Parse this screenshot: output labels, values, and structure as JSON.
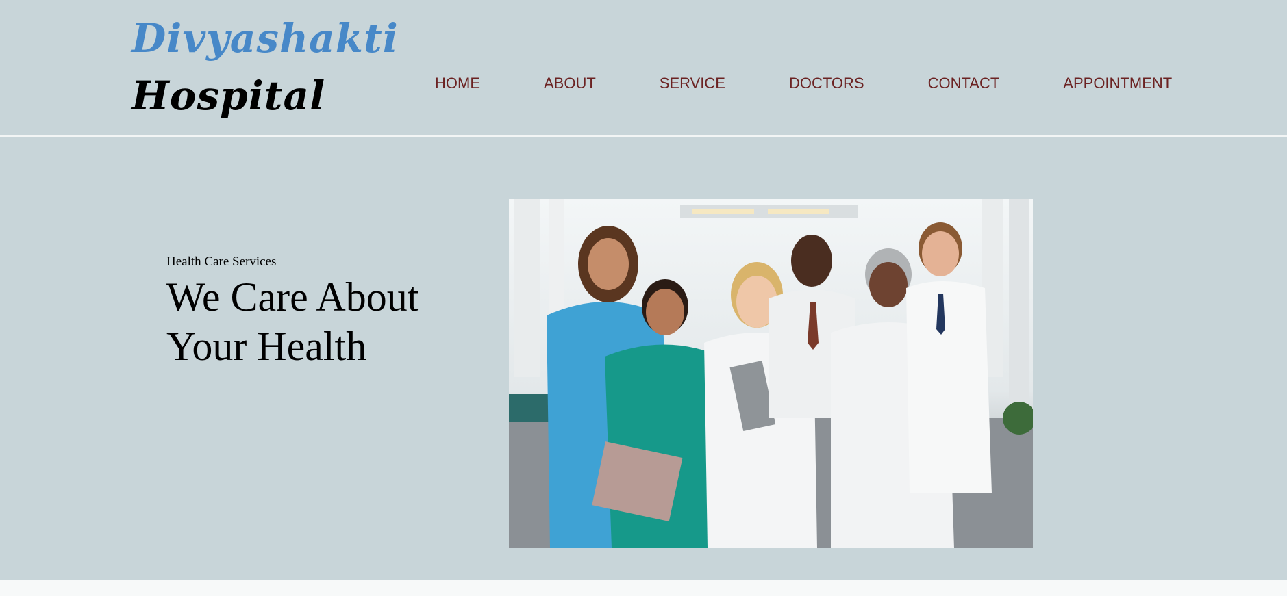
{
  "brand": {
    "line1": "Divyashakti",
    "line2": "Hospital"
  },
  "nav": {
    "items": [
      {
        "label": "HOME"
      },
      {
        "label": "ABOUT"
      },
      {
        "label": "SERVICE"
      },
      {
        "label": "DOCTORS"
      },
      {
        "label": "CONTACT"
      },
      {
        "label": "APPOINTMENT"
      }
    ]
  },
  "hero": {
    "kicker": "Health Care Services",
    "headline_line1": "We Care About",
    "headline_line2": "Your Health",
    "image": "medical-team-photo"
  },
  "colors": {
    "background": "#c8d5d9",
    "brand_blue": "#4788c8",
    "nav_text": "#6b2222"
  }
}
